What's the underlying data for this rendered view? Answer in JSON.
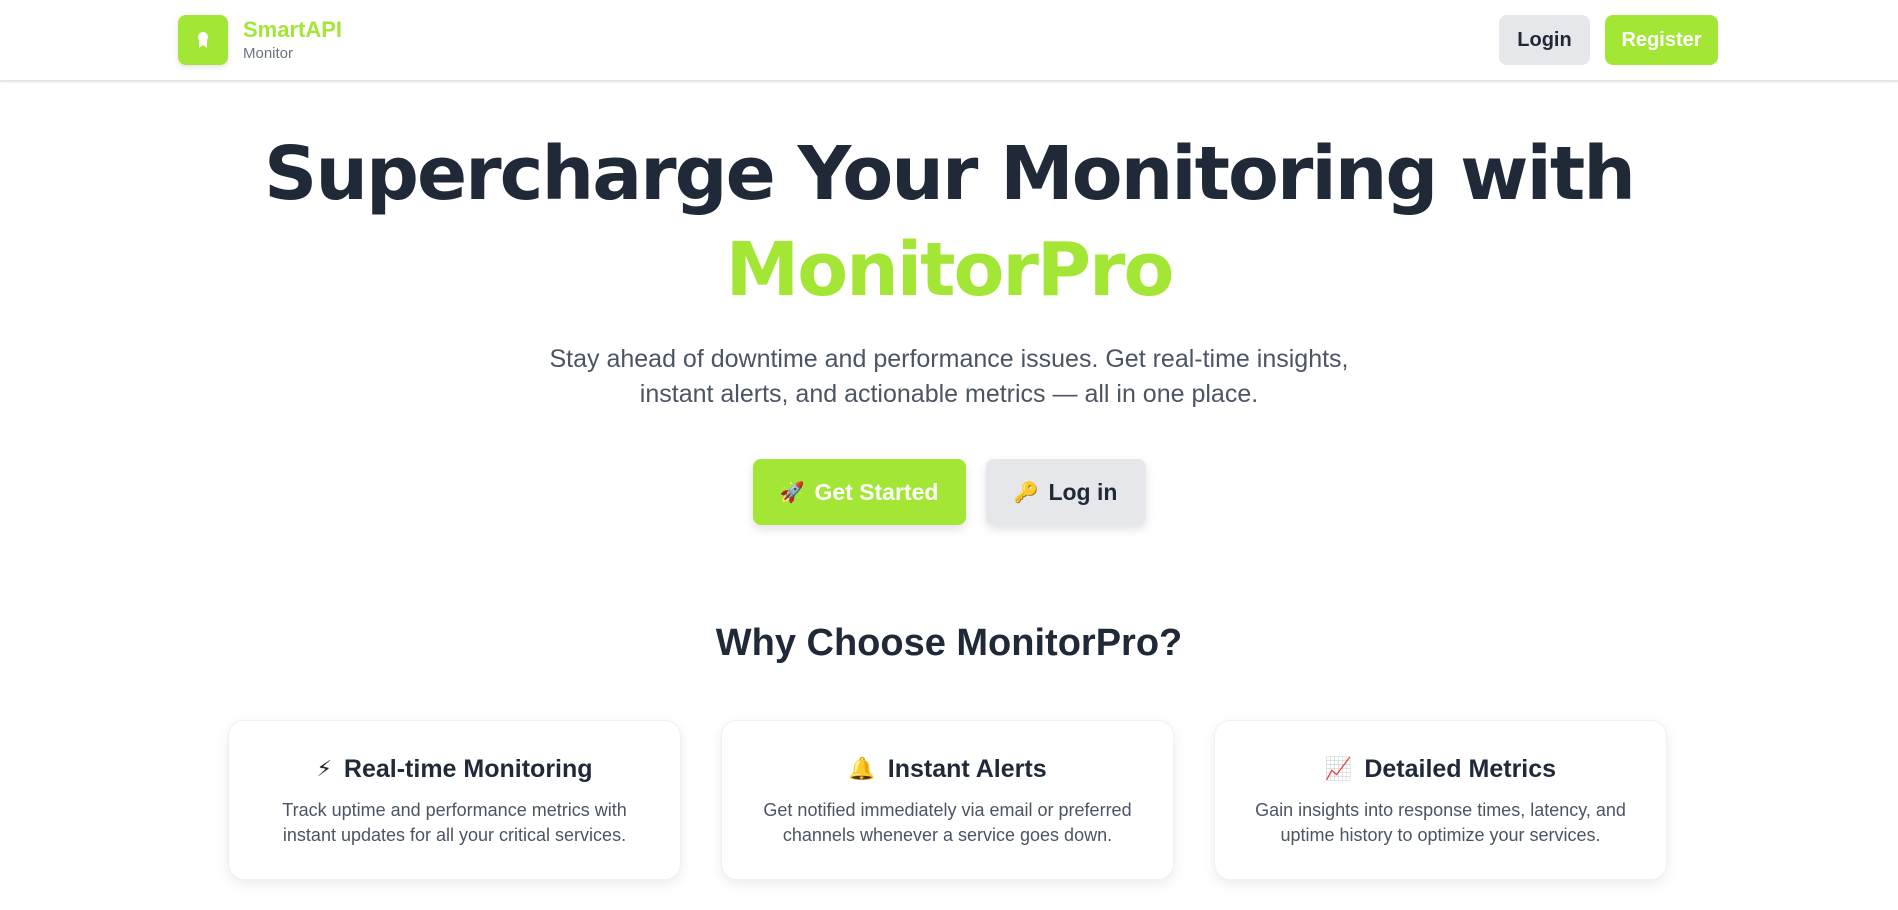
{
  "header": {
    "brand_name": "SmartAPI",
    "brand_sub": "Monitor",
    "login_label": "Login",
    "register_label": "Register"
  },
  "hero": {
    "title_main": "Supercharge Your Monitoring with",
    "title_accent": "MonitorPro",
    "subtitle_line1": "Stay ahead of downtime and performance issues. Get real-time insights,",
    "subtitle_line2": "instant alerts, and actionable metrics — all in one place.",
    "get_started_icon": "🚀",
    "get_started_label": "Get Started",
    "login_icon": "🔑",
    "login_label": "Log in"
  },
  "features": {
    "title": "Why Choose MonitorPro?",
    "cards": [
      {
        "icon": "⚡",
        "icon_name": "lightning-icon",
        "title": "Real-time Monitoring",
        "description": "Track uptime and performance metrics with instant updates for all your critical services."
      },
      {
        "icon": "🔔",
        "icon_name": "bell-icon",
        "title": "Instant Alerts",
        "description": "Get notified immediately via email or preferred channels whenever a service goes down."
      },
      {
        "icon": "📈",
        "icon_name": "chart-icon",
        "title": "Detailed Metrics",
        "description": "Gain insights into response times, latency, and uptime history to optimize your services."
      }
    ]
  },
  "colors": {
    "accent": "#a3e635",
    "text_dark": "#1f2937",
    "text_muted": "#4b5563",
    "button_gray": "#e5e7eb"
  }
}
